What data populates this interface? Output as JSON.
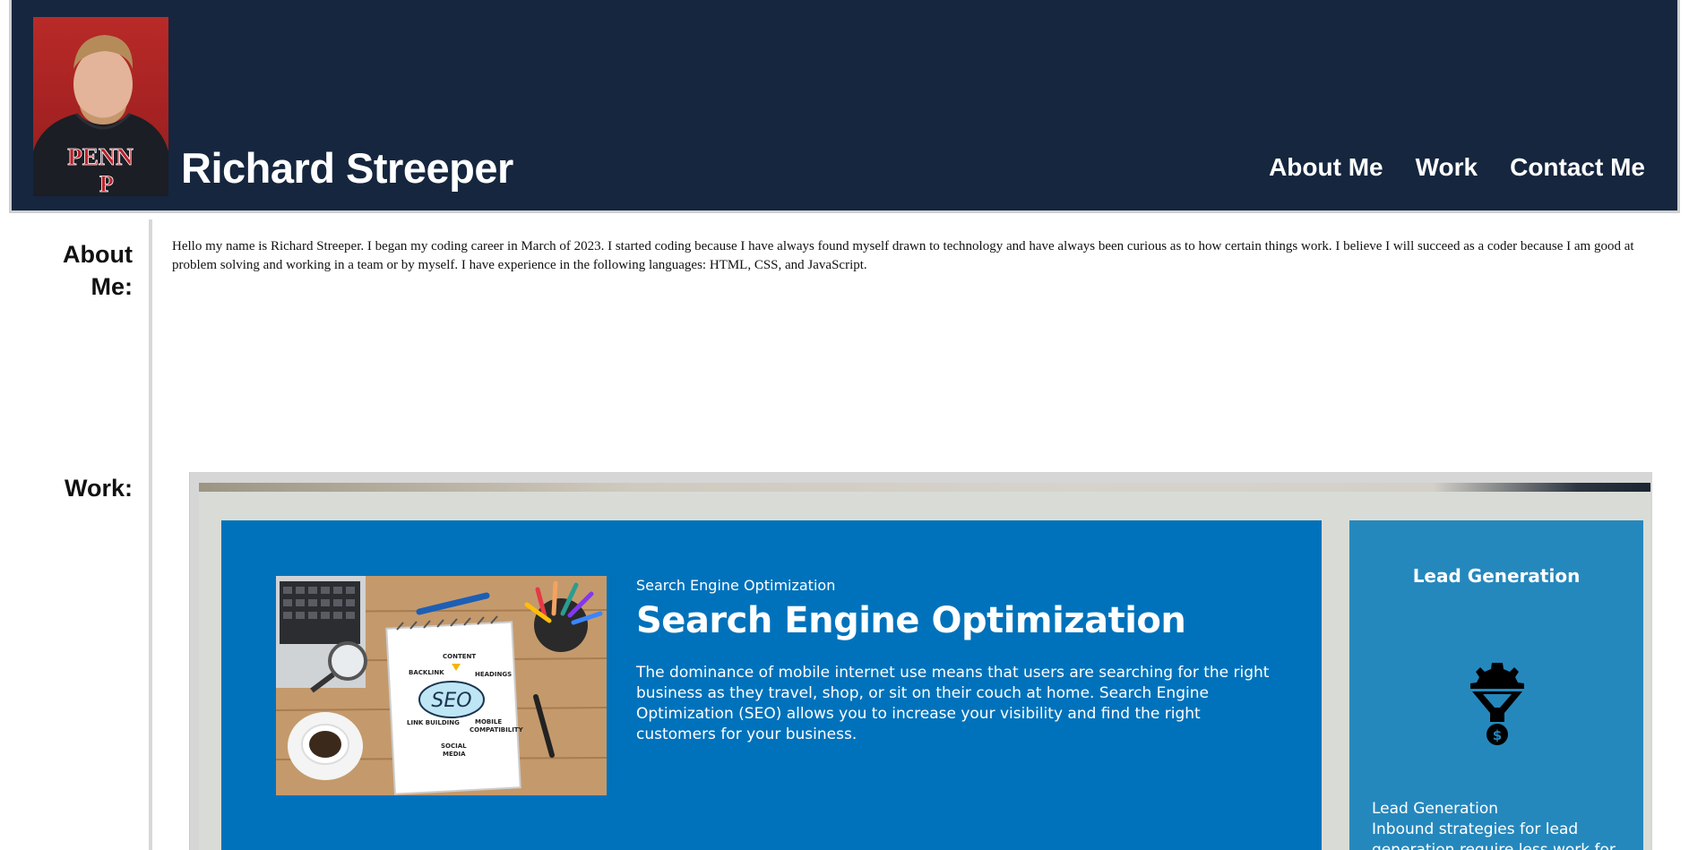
{
  "header": {
    "name": "Richard Streeper",
    "nav": [
      "About Me",
      "Work",
      "Contact Me"
    ],
    "avatar_shirt_text": "PENN"
  },
  "about": {
    "label": "About Me:",
    "text": "Hello my name is Richard Streeper. I began my coding career in March of 2023. I started coding because I have always found myself drawn to technology and have always been curious as to how certain things work. I believe I will succeed as a coder because I am good at problem solving and working in a team or by myself. I have experience in the following languages: HTML, CSS, and JavaScript."
  },
  "work": {
    "label": "Work:",
    "seo": {
      "kicker": "Search Engine Optimization",
      "title": "Search Engine Optimization",
      "body": "The dominance of mobile internet use means that users are searching for the right business as they travel, shop, or sit on their couch at home. Search Engine Optimization (SEO) allows you to increase your visibility and find the right customers for your business.",
      "image_words": [
        "SEO",
        "BACKLINK",
        "CONTENT",
        "HEADINGS",
        "LINK BUILDING",
        "MOBILE COMPATIBILITY",
        "SOCIAL MEDIA"
      ]
    },
    "lead": {
      "title": "Lead Generation",
      "subtitle": "Lead Generation",
      "body": "Inbound strategies for lead generation require less work for",
      "icon": "funnel-gear-dollar-icon"
    }
  },
  "colors": {
    "header_bg": "#15263e",
    "seo_card": "#0072bb",
    "lead_card": "#2588bd"
  }
}
